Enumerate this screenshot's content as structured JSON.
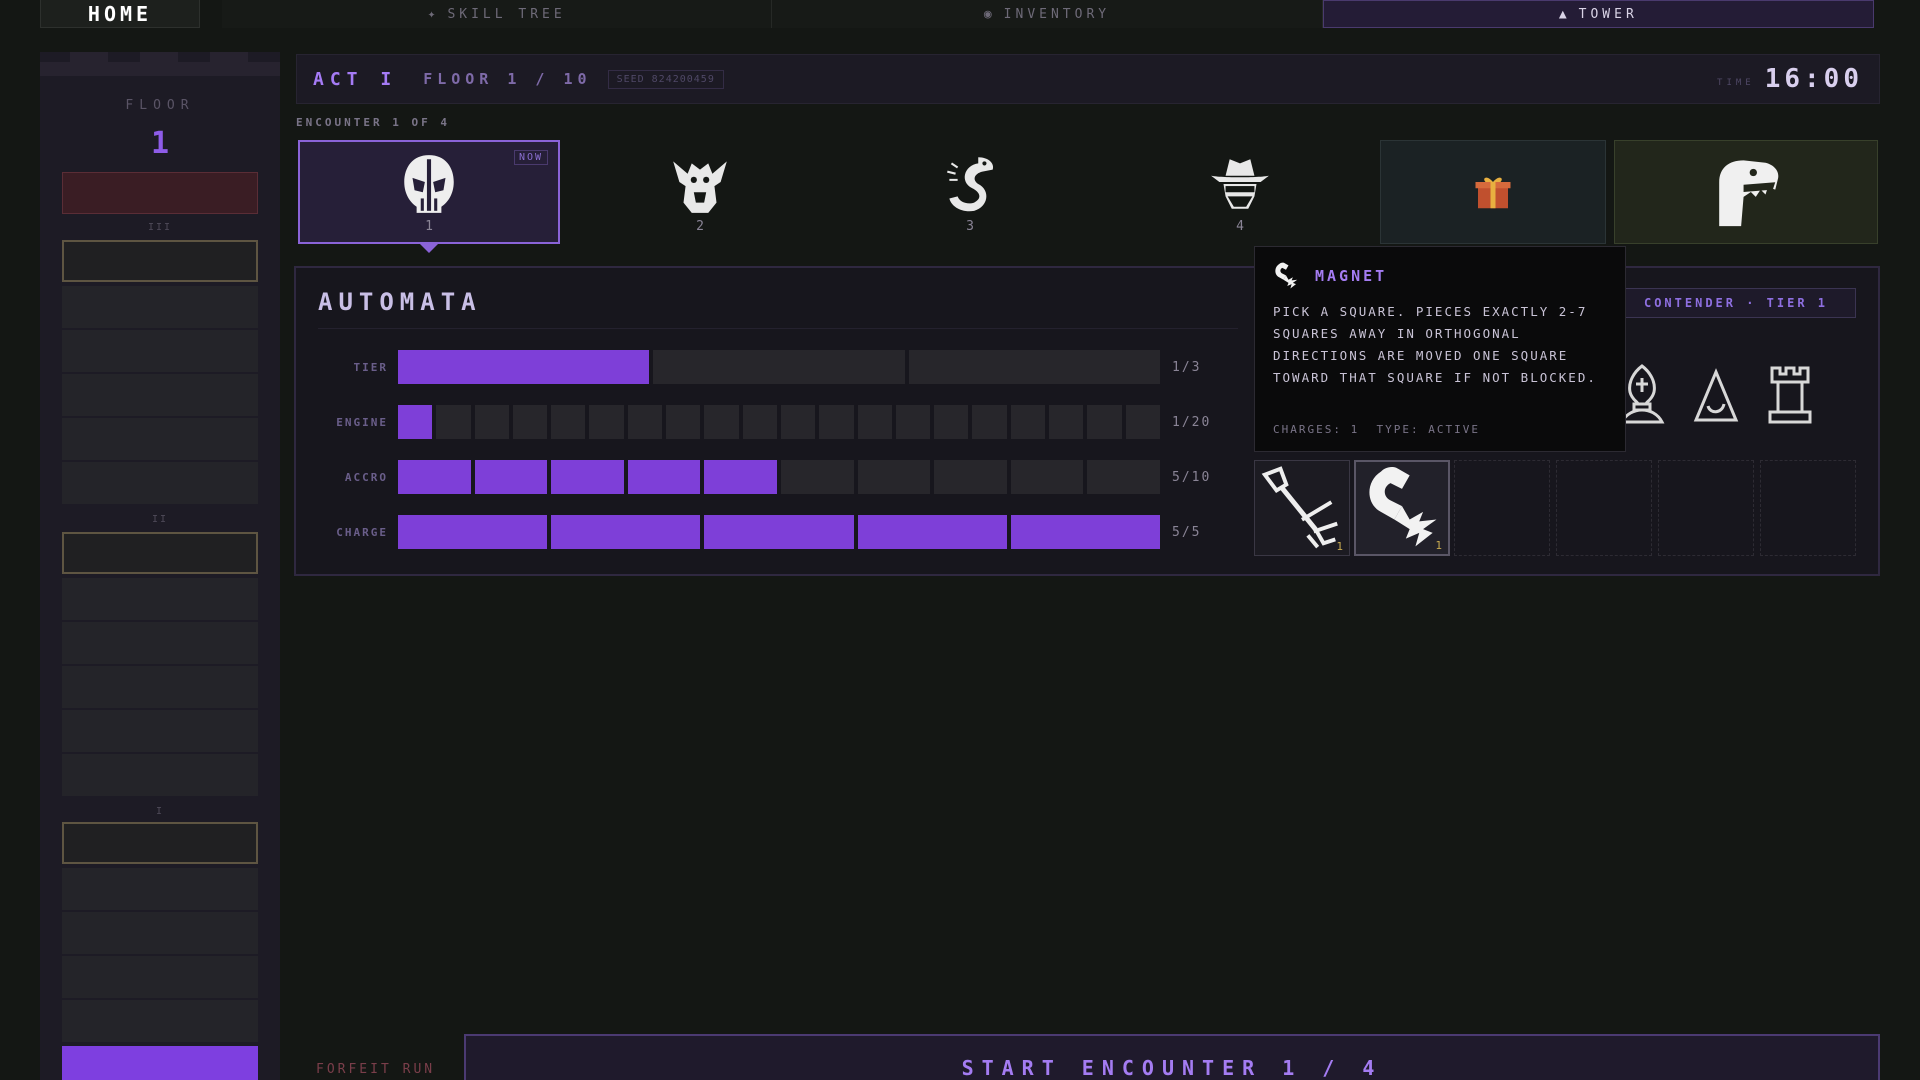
{
  "nav": {
    "home": "HOME",
    "tabs": [
      {
        "label": "SKILL TREE",
        "icon": "skill-tree-icon"
      },
      {
        "label": "INVENTORY",
        "icon": "inventory-icon"
      },
      {
        "label": "TOWER",
        "icon": "tower-icon",
        "active": true
      }
    ]
  },
  "tower": {
    "floor_label": "FLOOR",
    "floor_number": "1",
    "act_marks": [
      "III",
      "II",
      "I"
    ]
  },
  "header": {
    "act": "ACT I",
    "floor": "FLOOR 1 / 10",
    "seed": "SEED 824200459",
    "time_label": "TIME",
    "time": "16:00"
  },
  "encounters": {
    "label": "ENCOUNTER 1 OF 4",
    "now_badge": "NOW",
    "items": [
      {
        "num": "1",
        "icon": "skull-mask-icon"
      },
      {
        "num": "2",
        "icon": "gargoyle-icon"
      },
      {
        "num": "3",
        "icon": "serpent-icon"
      },
      {
        "num": "4",
        "icon": "bandit-icon"
      },
      {
        "num": "",
        "icon": "gift-icon"
      },
      {
        "num": "",
        "icon": "dinosaur-icon"
      }
    ]
  },
  "enemy": {
    "name": "AUTOMATA",
    "tier_badge": "CONTENDER · TIER 1",
    "stats": [
      {
        "label": "TIER",
        "value": "1/3",
        "filled": 1,
        "total": 3
      },
      {
        "label": "ENGINE",
        "value": "1/20",
        "filled": 1,
        "total": 20
      },
      {
        "label": "ACCRO",
        "value": "5/10",
        "filled": 5,
        "total": 10
      },
      {
        "label": "CHARGE",
        "value": "5/5",
        "filled": 5,
        "total": 5
      }
    ],
    "pieces": [
      "bishop-icon",
      "pawn-icon",
      "rook-icon"
    ]
  },
  "items": [
    {
      "icon": "grappling-hook-icon",
      "count": "1"
    },
    {
      "icon": "magnet-icon",
      "count": "1"
    }
  ],
  "tooltip": {
    "icon": "magnet-icon",
    "name": "MAGNET",
    "text": "PICK A SQUARE. PIECES EXACTLY 2-7 SQUARES AWAY IN ORTHOGONAL DIRECTIONS ARE MOVED ONE SQUARE TOWARD THAT SQUARE IF NOT BLOCKED.",
    "charges": "CHARGES: 1",
    "type": "TYPE: ACTIVE"
  },
  "footer": {
    "forfeit": "FORFEIT RUN",
    "start": "START ENCOUNTER 1 / 4"
  },
  "colors": {
    "accent": "#7e3fd8",
    "accent_text": "#a47cf2",
    "background": "#141714",
    "danger": "#7a3e4a"
  }
}
